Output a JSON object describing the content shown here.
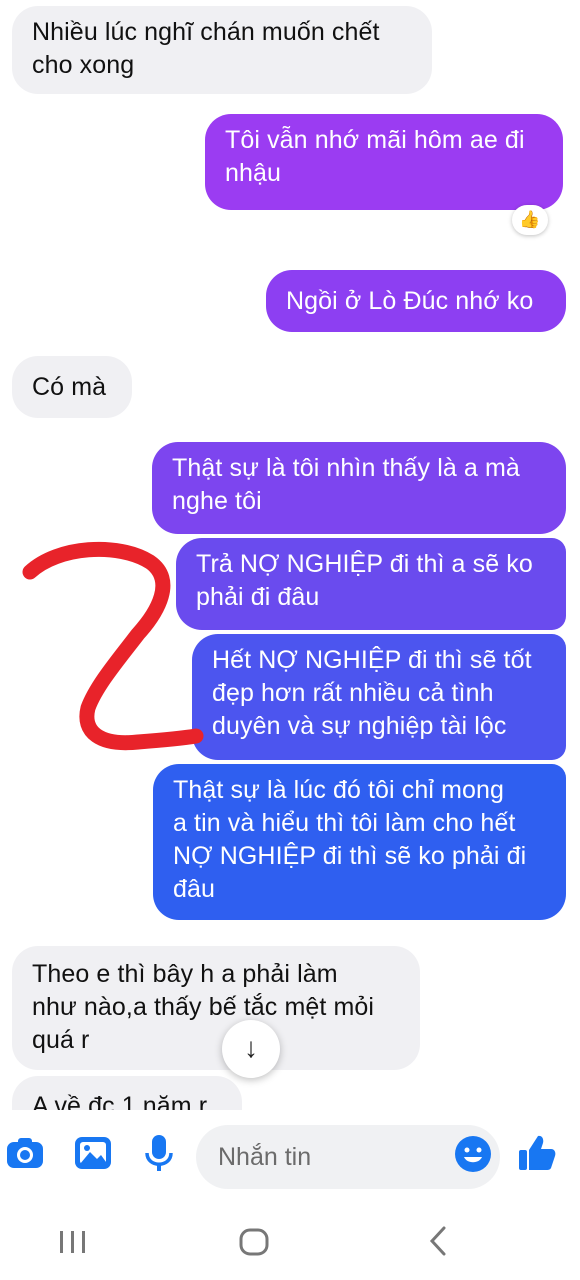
{
  "messages": [
    {
      "dir": "in",
      "text": "Nhiều lúc nghĩ chán muốn chết\ncho xong"
    },
    {
      "dir": "out",
      "text": "Tôi vẫn nhớ mãi hôm ae đi\nnhậu"
    },
    {
      "dir": "out",
      "text": "Ngồi ở Lò Đúc nhớ ko"
    },
    {
      "dir": "in",
      "text": "Có mà"
    },
    {
      "dir": "out",
      "text": "Thật sự là tôi nhìn thấy là a mà\nnghe tôi"
    },
    {
      "dir": "out",
      "text": "Trả NỢ NGHIỆP đi thì a sẽ ko\nphải đi đâu"
    },
    {
      "dir": "out",
      "text": "Hết NỢ NGHIỆP đi thì sẽ tốt\nđẹp hơn rất nhiều cả tình\nduyên và sự nghiệp tài lộc"
    },
    {
      "dir": "out",
      "text": "Thật sự là lúc đó tôi chỉ mong\na tin và hiểu thì tôi làm cho hết\nNỢ NGHIỆP đi thì sẽ ko phải đi\nđâu"
    },
    {
      "dir": "in",
      "text": "Theo e thì bây h a phải làm\nnhư nào,a thấy bế tắc mệt mỏi\nquá r"
    },
    {
      "dir": "in",
      "text": "A về đc 1 năm r"
    }
  ],
  "reaction": {
    "emoji": "👍",
    "icon": "thumbs-up-icon"
  },
  "scroll_button": {
    "glyph": "↓",
    "icon": "arrow-down-icon"
  },
  "composer": {
    "placeholder": "Nhắn tin",
    "icons": [
      "camera-icon",
      "gallery-icon",
      "microphone-icon",
      "emoji-icon",
      "like-icon"
    ],
    "accent": "#1877f2"
  },
  "colors": {
    "incoming": "#f0f0f3",
    "outgoing_top": "#8a3cf0",
    "outgoing_bottom": "#2f5ff0",
    "annotation": "#e8232a"
  },
  "navbar": {
    "icons": [
      "recent-apps-icon",
      "home-icon",
      "back-icon"
    ]
  }
}
